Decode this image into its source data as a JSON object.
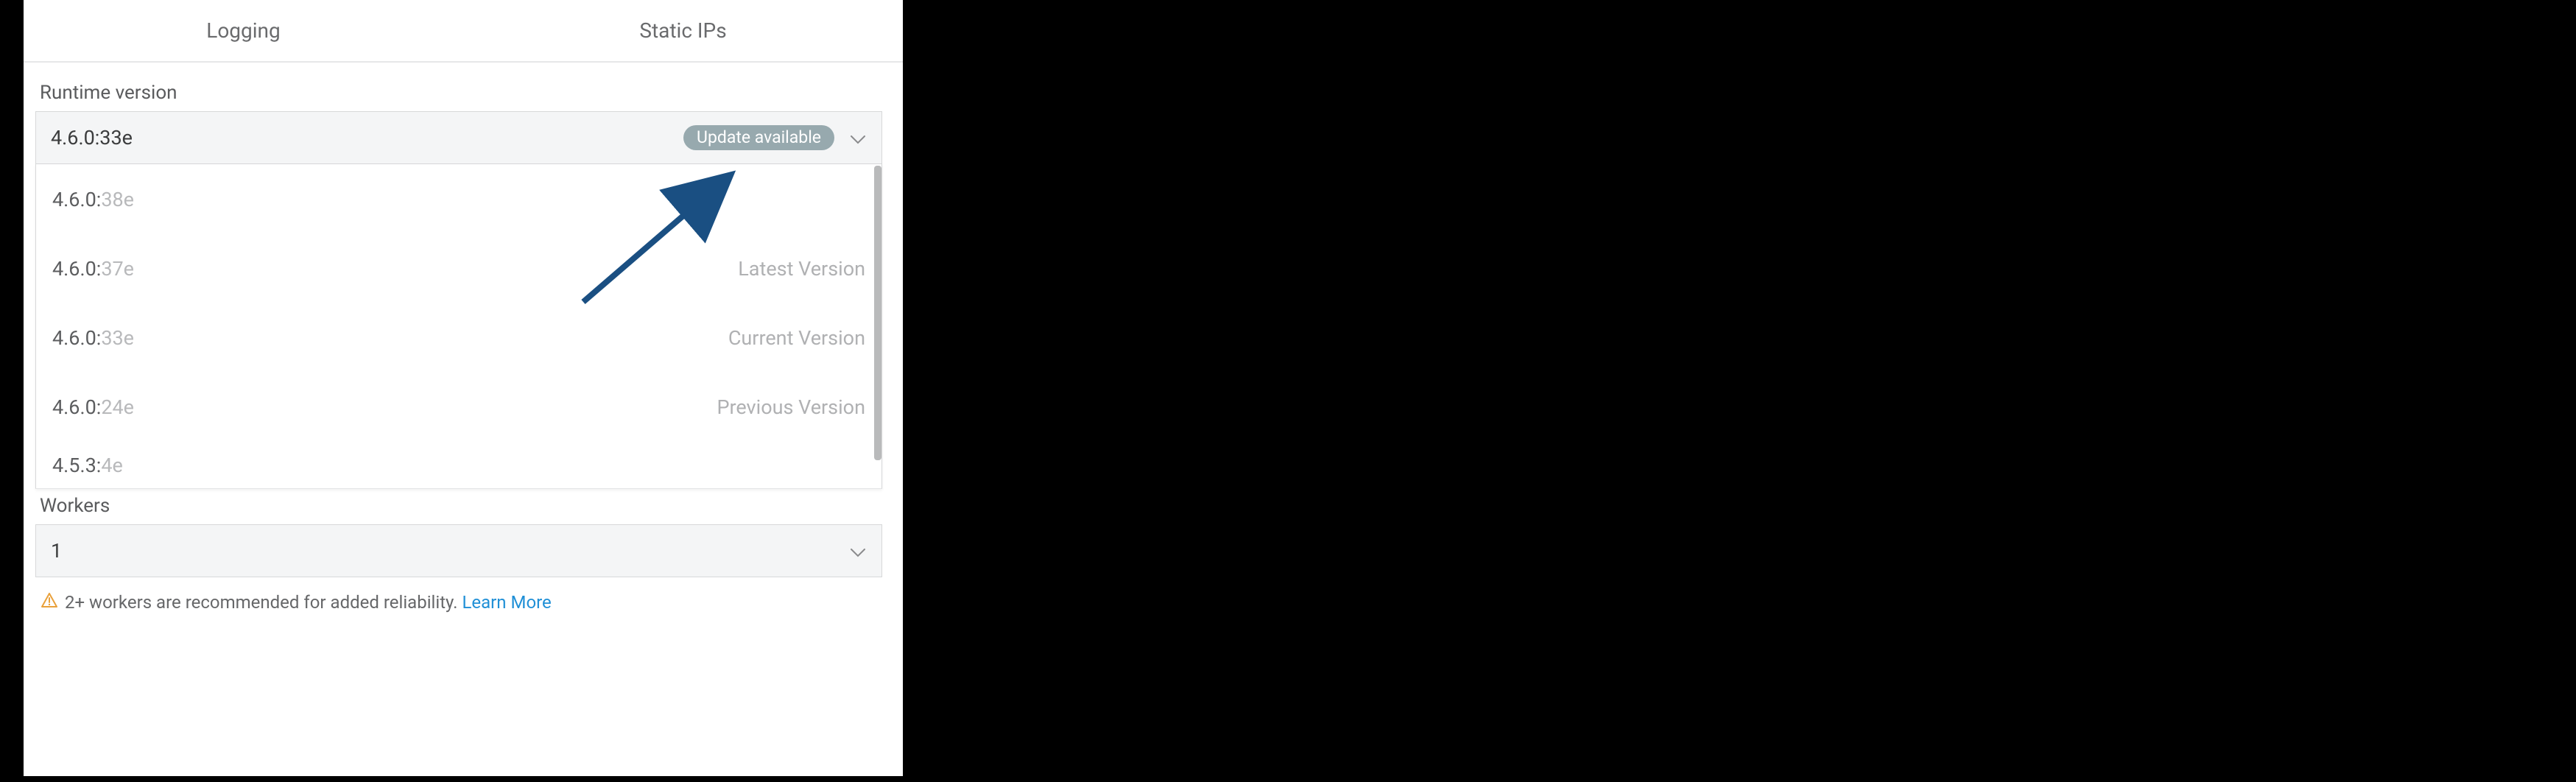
{
  "tabs": {
    "logging": "Logging",
    "static_ips": "Static IPs"
  },
  "runtime": {
    "label": "Runtime version",
    "selected": "4.6.0:33e",
    "badge": "Update available",
    "options": [
      {
        "prefix": "4.6.0:",
        "suffix": "38e",
        "note": ""
      },
      {
        "prefix": "4.6.0:",
        "suffix": "37e",
        "note": "Latest Version"
      },
      {
        "prefix": "4.6.0:",
        "suffix": "33e",
        "note": "Current Version"
      },
      {
        "prefix": "4.6.0:",
        "suffix": "24e",
        "note": "Previous Version"
      },
      {
        "prefix": "4.5.3:",
        "suffix": "4e",
        "note": ""
      }
    ]
  },
  "workers": {
    "label": "Workers",
    "selected": "1"
  },
  "hint": {
    "text": "2+ workers are recommended for added reliability. ",
    "link": "Learn More"
  }
}
